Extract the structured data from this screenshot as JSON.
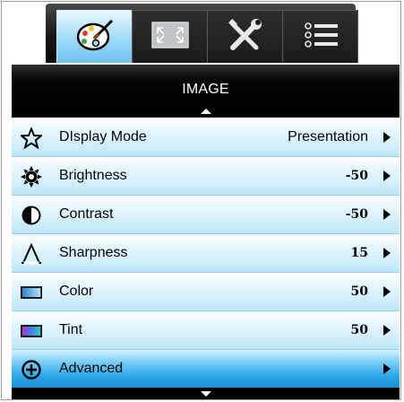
{
  "tabs": [
    {
      "icon": "palette-icon",
      "active": true
    },
    {
      "icon": "screen-expand-icon",
      "active": false
    },
    {
      "icon": "tools-icon",
      "active": false
    },
    {
      "icon": "list-icon",
      "active": false
    }
  ],
  "header": {
    "title": "IMAGE"
  },
  "menu": {
    "items": [
      {
        "icon": "star-icon",
        "label": "DIsplay Mode",
        "value": "Presentation"
      },
      {
        "icon": "sun-icon",
        "label": "Brightness",
        "value": "-50"
      },
      {
        "icon": "contrast-icon",
        "label": "Contrast",
        "value": "-50"
      },
      {
        "icon": "sharpness-icon",
        "label": "Sharpness",
        "value": "15"
      },
      {
        "icon": "color-swatch-icon",
        "label": "Color",
        "value": "50"
      },
      {
        "icon": "tint-swatch-icon",
        "label": "Tint",
        "value": "50"
      },
      {
        "icon": "plus-circle-icon",
        "label": "Advanced",
        "value": "",
        "selected": true
      }
    ]
  },
  "colors": {
    "row_bg": "#cdeefb",
    "selected_bg": "#2aa7e8",
    "header_bg": "#000000",
    "active_tab": "#9fd9f7"
  }
}
